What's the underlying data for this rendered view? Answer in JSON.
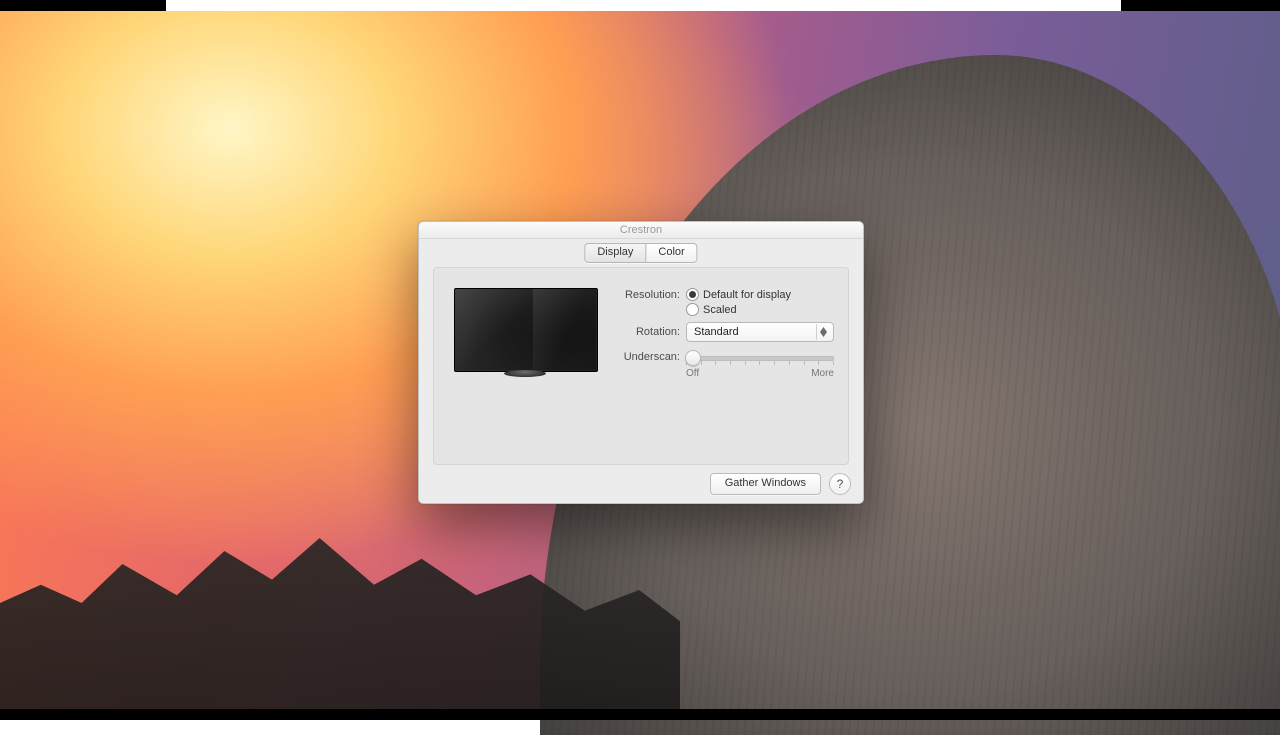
{
  "window": {
    "title": "Crestron",
    "tabs": [
      "Display",
      "Color"
    ],
    "active_tab": "Display"
  },
  "settings": {
    "resolution": {
      "label": "Resolution:",
      "options": [
        "Default for display",
        "Scaled"
      ],
      "selected": "Default for display"
    },
    "rotation": {
      "label": "Rotation:",
      "value": "Standard"
    },
    "underscan": {
      "label": "Underscan:",
      "min_label": "Off",
      "max_label": "More",
      "value": 0,
      "ticks": 11
    }
  },
  "footer": {
    "gather_label": "Gather Windows",
    "help_label": "?"
  },
  "icons": {
    "monitor": "monitor-icon",
    "select_arrows": "select-stepper-icon",
    "help": "help-icon"
  }
}
